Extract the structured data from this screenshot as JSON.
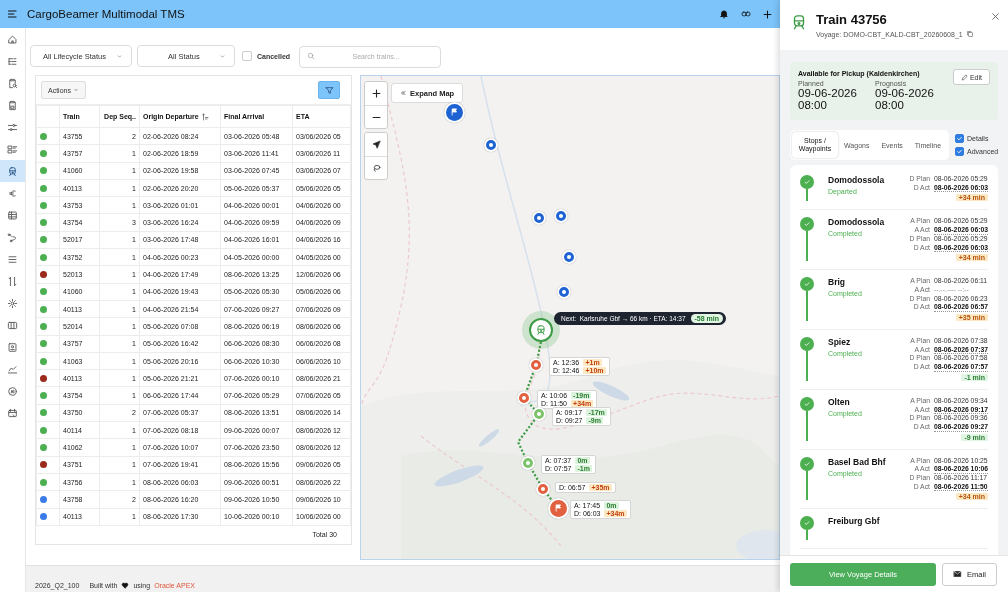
{
  "header": {
    "title": "CargoBeamer Multimodal TMS"
  },
  "sidebar": {
    "items": [
      {
        "selected": false
      },
      {
        "selected": false
      },
      {
        "selected": false
      },
      {
        "selected": false
      },
      {
        "selected": false
      },
      {
        "selected": false
      },
      {
        "selected": true
      },
      {
        "selected": false
      },
      {
        "selected": false
      },
      {
        "selected": false
      },
      {
        "selected": false
      },
      {
        "selected": false
      },
      {
        "selected": false
      },
      {
        "selected": false
      },
      {
        "selected": false
      },
      {
        "selected": false
      },
      {
        "selected": false
      },
      {
        "selected": false
      }
    ]
  },
  "filters": {
    "lifecycle": "All Lifecycle Status",
    "status": "All Status",
    "cancelled": {
      "label": "Cancelled",
      "checked": false
    },
    "search": {
      "placeholder": "Search trains..."
    }
  },
  "table": {
    "actions": "Actions",
    "columns": [
      {
        "label": "Train",
        "sorted": false
      },
      {
        "label": "Dep Seq..",
        "sorted": false
      },
      {
        "label": "Origin Departure",
        "sorted": true
      },
      {
        "label": "Final Arrival",
        "sorted": false
      },
      {
        "label": "ETA",
        "sorted": false
      }
    ],
    "rows": [
      {
        "color": "#4caf50",
        "train": "43755",
        "dep_seq": "2",
        "origin_departure": "02-06-2026 08:24",
        "final_arrival": "03-06-2026 05:48",
        "eta": "03/06/2026 05"
      },
      {
        "color": "#4caf50",
        "train": "43757",
        "dep_seq": "1",
        "origin_departure": "02-06-2026 18:59",
        "final_arrival": "03-06-2026 11:41",
        "eta": "03/06/2026 11"
      },
      {
        "color": "#4caf50",
        "train": "41060",
        "dep_seq": "1",
        "origin_departure": "02-06-2026 19:58",
        "final_arrival": "03-06-2026 07:45",
        "eta": "03/06/2026 07"
      },
      {
        "color": "#4caf50",
        "train": "40113",
        "dep_seq": "1",
        "origin_departure": "02-06-2026 20:20",
        "final_arrival": "05-06-2026 05:37",
        "eta": "05/06/2026 05"
      },
      {
        "color": "#4caf50",
        "train": "43753",
        "dep_seq": "1",
        "origin_departure": "03-06-2026 01:01",
        "final_arrival": "04-06-2026 00:01",
        "eta": "04/06/2026 00"
      },
      {
        "color": "#4caf50",
        "train": "43754",
        "dep_seq": "3",
        "origin_departure": "03-06-2026 16:24",
        "final_arrival": "04-06-2026 09:59",
        "eta": "04/06/2026 09"
      },
      {
        "color": "#4caf50",
        "train": "52017",
        "dep_seq": "1",
        "origin_departure": "03-06-2026 17:48",
        "final_arrival": "04-06-2026 16:01",
        "eta": "04/06/2026 16"
      },
      {
        "color": "#4caf50",
        "train": "43752",
        "dep_seq": "1",
        "origin_departure": "04-06-2026 00:23",
        "final_arrival": "04-05-2026 00:00",
        "eta": "04/05/2026 00"
      },
      {
        "color": "#9b2a1a",
        "train": "52013",
        "dep_seq": "1",
        "origin_departure": "04-06-2026 17:49",
        "final_arrival": "08-06-2026 13:25",
        "eta": "12/06/2026 06"
      },
      {
        "color": "#4caf50",
        "train": "41060",
        "dep_seq": "1",
        "origin_departure": "04-06-2026 19:43",
        "final_arrival": "05-06-2026 05:30",
        "eta": "05/06/2026 06"
      },
      {
        "color": "#4caf50",
        "train": "40113",
        "dep_seq": "1",
        "origin_departure": "04-06-2026 21:54",
        "final_arrival": "07-06-2026 09:27",
        "eta": "07/06/2026 09"
      },
      {
        "color": "#4caf50",
        "train": "52014",
        "dep_seq": "1",
        "origin_departure": "05-06-2026 07:08",
        "final_arrival": "08-06-2026 06:19",
        "eta": "08/06/2026 06"
      },
      {
        "color": "#4caf50",
        "train": "43757",
        "dep_seq": "1",
        "origin_departure": "05-06-2026 16:42",
        "final_arrival": "06-06-2026 08:30",
        "eta": "06/06/2026 08"
      },
      {
        "color": "#4caf50",
        "train": "41063",
        "dep_seq": "1",
        "origin_departure": "05-06-2026 20:16",
        "final_arrival": "06-06-2026 10:30",
        "eta": "06/06/2026 10"
      },
      {
        "color": "#9b2a1a",
        "train": "40113",
        "dep_seq": "1",
        "origin_departure": "05-06-2026 21:21",
        "final_arrival": "07-06-2026 00:10",
        "eta": "08/06/2026 21"
      },
      {
        "color": "#4caf50",
        "train": "43754",
        "dep_seq": "1",
        "origin_departure": "06-06-2026 17:44",
        "final_arrival": "07-06-2026 05:29",
        "eta": "07/06/2026 05"
      },
      {
        "color": "#4caf50",
        "train": "43750",
        "dep_seq": "2",
        "origin_departure": "07-06-2026 05:37",
        "final_arrival": "08-06-2026 13:51",
        "eta": "08/06/2026 14"
      },
      {
        "color": "#4caf50",
        "train": "40114",
        "dep_seq": "1",
        "origin_departure": "07-06-2026 08:18",
        "final_arrival": "09-06-2026 00:07",
        "eta": "08/06/2026 12"
      },
      {
        "color": "#4caf50",
        "train": "41062",
        "dep_seq": "1",
        "origin_departure": "07-06-2026 10:07",
        "final_arrival": "07-06-2026 23:50",
        "eta": "08/06/2026 12"
      },
      {
        "color": "#9b2a1a",
        "train": "43751",
        "dep_seq": "1",
        "origin_departure": "07-06-2026 19:41",
        "final_arrival": "08-06-2026 15:56",
        "eta": "09/06/2026 05"
      },
      {
        "color": "#4caf50",
        "train": "43756",
        "dep_seq": "1",
        "origin_departure": "08-06-2026 06:03",
        "final_arrival": "09-06-2026 00:51",
        "eta": "08/06/2026 22"
      },
      {
        "color": "#3b7be8",
        "train": "43758",
        "dep_seq": "2",
        "origin_departure": "08-06-2026 16:20",
        "final_arrival": "09-06-2026 10:50",
        "eta": "09/06/2026 10"
      },
      {
        "color": "#3b7be8",
        "train": "40113",
        "dep_seq": "1",
        "origin_departure": "08-06-2026 17:30",
        "final_arrival": "10-06-2026 00:10",
        "eta": "10/06/2026 00"
      }
    ],
    "total": "Total 30"
  },
  "map": {
    "expand": "Expand Map",
    "next": {
      "text": "Next:  Karlsruhe Gbf → 66 km · ETA: 14:37",
      "delay": "-58 min"
    },
    "markers": [
      {
        "kind": "origin",
        "color": "#1f63d2"
      },
      {
        "kind": "waypoint",
        "color": "#1f63d2"
      },
      {
        "kind": "waypoint",
        "color": "#1f63d2"
      },
      {
        "kind": "waypoint",
        "color": "#1f63d2"
      },
      {
        "kind": "waypoint",
        "color": "#1f63d2"
      },
      {
        "kind": "waypoint",
        "color": "#1f63d2"
      },
      {
        "kind": "train",
        "color": "#3d9a45"
      },
      {
        "kind": "stop",
        "color": "#e0603f",
        "times": [
          {
            "text": "A: 12:36",
            "delay": "+1m",
            "kind": "late"
          },
          {
            "text": "D: 12:46",
            "delay": "+10m",
            "kind": "late"
          }
        ]
      },
      {
        "kind": "stop",
        "color": "#e0603f",
        "times": [
          {
            "text": "A: 10:06",
            "delay": "-19m",
            "kind": "early"
          },
          {
            "text": "D: 11:50",
            "delay": "+34m",
            "kind": "late"
          }
        ]
      },
      {
        "kind": "stop",
        "color": "#7cc36b",
        "times": [
          {
            "text": "A: 09:17",
            "delay": "-17m",
            "kind": "early"
          },
          {
            "text": "D: 09:27",
            "delay": "-9m",
            "kind": "early"
          }
        ]
      },
      {
        "kind": "stop",
        "color": "#7cc36b",
        "times": [
          {
            "text": "A: 07:37",
            "delay": "0m",
            "kind": "early"
          },
          {
            "text": "D: 07:57",
            "delay": "-1m",
            "kind": "early"
          }
        ]
      },
      {
        "kind": "stop",
        "color": "#e0603f",
        "times": [
          {
            "text": "D: 06:57",
            "delay": "+35m",
            "kind": "late"
          }
        ]
      },
      {
        "kind": "destination",
        "color": "#e0603f",
        "times": [
          {
            "text": "A: 17:45",
            "delay": "0m",
            "kind": "early"
          },
          {
            "text": "D: 06:03",
            "delay": "+34m",
            "kind": "late"
          }
        ]
      }
    ]
  },
  "panel": {
    "title": "Train 43756",
    "voyage": "Voyage: DOMO-CBT_KALD-CBT_20260608_1",
    "pickup": {
      "title": "Available for Pickup (Kaldenkirchen)",
      "edit": "Edit",
      "planned_label": "Planned",
      "planned": "09-06-2026 08:00",
      "prognosis_label": "Prognosis",
      "prognosis": "09-06-2026 08:00"
    },
    "tabs": [
      {
        "label": "Stops / Waypoints",
        "selected": true
      },
      {
        "label": "Wagons",
        "selected": false
      },
      {
        "label": "Events",
        "selected": false
      },
      {
        "label": "Timeline",
        "selected": false
      }
    ],
    "options": [
      {
        "label": "Details",
        "checked": true
      },
      {
        "label": "Advanced",
        "checked": true
      }
    ],
    "stops": [
      {
        "name": "Domodossola",
        "status": "Departed",
        "times": [
          {
            "label": "D Plan",
            "value": "08-06-2026 05:29",
            "kind": "plan"
          },
          {
            "label": "D Act",
            "value": "08-06-2026 06:03",
            "kind": "act"
          }
        ],
        "delay": {
          "text": "+34 min",
          "kind": "late"
        }
      },
      {
        "name": "Domodossola",
        "status": "Completed",
        "times": [
          {
            "label": "A Plan",
            "value": "08-06-2026 05:29",
            "kind": "plan"
          },
          {
            "label": "A Act",
            "value": "08-06-2026 06:03",
            "kind": "act"
          },
          {
            "label": "D Plan",
            "value": "08-06-2026 05:29",
            "kind": "plan"
          },
          {
            "label": "D Act",
            "value": "08-06-2026 06:03",
            "kind": "act"
          }
        ],
        "delay": {
          "text": "+34 min",
          "kind": "late"
        }
      },
      {
        "name": "Brig",
        "status": "Completed",
        "times": [
          {
            "label": "A Plan",
            "value": "08-06-2026 06:11",
            "kind": "plan"
          },
          {
            "label": "A Act",
            "value": "--.--.---- --:--",
            "kind": "empty"
          },
          {
            "label": "D Plan",
            "value": "08-06-2026 06:23",
            "kind": "plan"
          },
          {
            "label": "D Act",
            "value": "08-06-2026 06:57",
            "kind": "act"
          }
        ],
        "delay": {
          "text": "+35 min",
          "kind": "late"
        }
      },
      {
        "name": "Spiez",
        "status": "Completed",
        "times": [
          {
            "label": "A Plan",
            "value": "08-06-2026 07:38",
            "kind": "plan"
          },
          {
            "label": "A Act",
            "value": "08-06-2026 07:37",
            "kind": "act"
          },
          {
            "label": "D Plan",
            "value": "08-06-2026 07:58",
            "kind": "plan"
          },
          {
            "label": "D Act",
            "value": "08-06-2026 07:57",
            "kind": "act"
          }
        ],
        "delay": {
          "text": "-1 min",
          "kind": "early"
        }
      },
      {
        "name": "Olten",
        "status": "Completed",
        "times": [
          {
            "label": "A Plan",
            "value": "08-06-2026 09:34",
            "kind": "plan"
          },
          {
            "label": "A Act",
            "value": "08-06-2026 09:17",
            "kind": "act"
          },
          {
            "label": "D Plan",
            "value": "08-06-2026 09:36",
            "kind": "plan"
          },
          {
            "label": "D Act",
            "value": "08-06-2026 09:27",
            "kind": "act"
          }
        ],
        "delay": {
          "text": "-9 min",
          "kind": "early"
        }
      },
      {
        "name": "Basel Bad Bhf",
        "status": "Completed",
        "times": [
          {
            "label": "A Plan",
            "value": "08-06-2026 10:25",
            "kind": "plan"
          },
          {
            "label": "A Act",
            "value": "08-06-2026 10:06",
            "kind": "act"
          },
          {
            "label": "D Plan",
            "value": "08-06-2026 11:17",
            "kind": "plan"
          },
          {
            "label": "D Act",
            "value": "08-06-2026 11:50",
            "kind": "act"
          }
        ],
        "delay": {
          "text": "+34 min",
          "kind": "late"
        }
      },
      {
        "name": "Freiburg Gbf"
      }
    ],
    "buttons": {
      "details": "View Voyage Details",
      "email": "Email"
    }
  },
  "footer": {
    "version": "2026_Q2_100",
    "built_with": "Built with",
    "using": "using",
    "link": "Oracle APEX"
  }
}
